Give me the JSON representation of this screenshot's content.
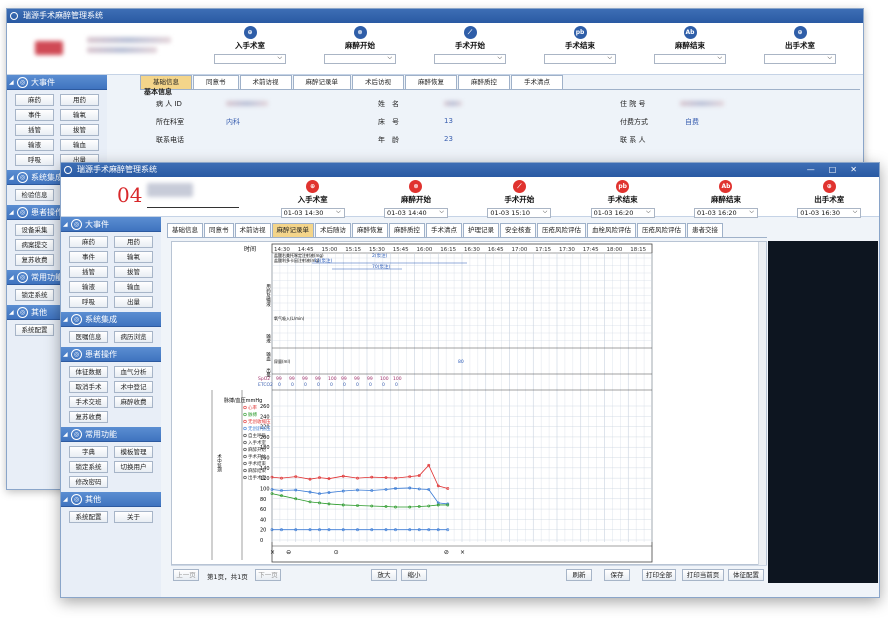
{
  "back_window": {
    "title": "瑞源手术麻醉管理系统",
    "steps": [
      {
        "label": "入手术室",
        "icon": "room-enter-icon",
        "glyph": "⊕"
      },
      {
        "label": "麻醉开始",
        "icon": "anesthesia-start-icon",
        "glyph": "⊗"
      },
      {
        "label": "手术开始",
        "icon": "scalpel-icon",
        "glyph": "⟋"
      },
      {
        "label": "手术结束",
        "icon": "surgery-end-icon",
        "glyph": "pb"
      },
      {
        "label": "麻醉结束",
        "icon": "anesthesia-end-icon",
        "glyph": "Ab"
      },
      {
        "label": "出手术室",
        "icon": "room-exit-icon",
        "glyph": "⊕"
      }
    ],
    "sidebar": {
      "groups": [
        {
          "label": "大事件",
          "buttons": [
            "麻药",
            "用药",
            "事件",
            "输氧",
            "插管",
            "拔管",
            "输液",
            "输血",
            "呼吸",
            "出量"
          ]
        },
        {
          "label": "系统集成",
          "buttons": [
            "检验信息",
            "病历浏览"
          ]
        },
        {
          "label": "患者操作",
          "buttons": [
            "设备采集",
            "血气分析",
            "病案提交",
            "手术交班",
            "复苏收费"
          ]
        },
        {
          "label": "常用功能",
          "buttons": [
            "锁定系统",
            "字典"
          ]
        },
        {
          "label": "其他",
          "buttons": [
            "系统配置"
          ]
        }
      ]
    },
    "tabs": [
      "基础信息",
      "同意书",
      "术前访视",
      "麻醉记录单",
      "术后访视",
      "麻醉恢复",
      "麻醉质控",
      "手术清点"
    ],
    "info": {
      "section_title": "基本信息",
      "patient_id_label": "病 人 ID",
      "name_label": "姓　名",
      "inpatient_no_label": "住 院 号",
      "dept_label": "所在科室",
      "dept_value": "内科",
      "bed_label": "床　号",
      "bed_value": "13",
      "pay_label": "付费方式",
      "pay_value": "自费",
      "phone_label": "联系电话",
      "age_label": "年　龄",
      "age_value": "23",
      "contact_label": "联 系 人"
    }
  },
  "front_window": {
    "title": "瑞源手术麻醉管理系统",
    "room_no": "04",
    "window_controls": [
      "—",
      "□",
      "✕"
    ],
    "steps": [
      {
        "label": "入手术室",
        "value": "01-03 14:30",
        "icon": "room-enter-icon",
        "glyph": "⊕"
      },
      {
        "label": "麻醉开始",
        "value": "01-03 14:40",
        "icon": "anesthesia-start-icon",
        "glyph": "⊗"
      },
      {
        "label": "手术开始",
        "value": "01-03 15:10",
        "icon": "scalpel-icon",
        "glyph": "⟋"
      },
      {
        "label": "手术结束",
        "value": "01-03 16:20",
        "icon": "surgery-end-icon",
        "glyph": "pb"
      },
      {
        "label": "麻醉结束",
        "value": "01-03 16:20",
        "icon": "anesthesia-end-icon",
        "glyph": "Ab"
      },
      {
        "label": "出手术室",
        "value": "01-03 16:30",
        "icon": "room-exit-icon",
        "glyph": "⊕"
      }
    ],
    "sidebar": {
      "groups": [
        {
          "label": "大事件",
          "buttons": [
            "麻药",
            "用药",
            "事件",
            "输氧",
            "插管",
            "拔管",
            "输液",
            "输血",
            "呼吸",
            "出量"
          ]
        },
        {
          "label": "系统集成",
          "buttons": [
            "医嘱信息",
            "病历浏览"
          ]
        },
        {
          "label": "患者操作",
          "buttons": [
            "体征数据",
            "血气分析",
            "取消手术",
            "术中登记",
            "手术交班",
            "麻醉收费",
            "复苏收费"
          ]
        },
        {
          "label": "常用功能",
          "buttons": [
            "字典",
            "模板管理",
            "锁定系统",
            "切换用户",
            "修改密码"
          ]
        },
        {
          "label": "其他",
          "buttons": [
            "系统配置",
            "关于"
          ]
        }
      ]
    },
    "tabs": [
      "基础信息",
      "同意书",
      "术前访视",
      "麻醉记录单",
      "术后随访",
      "麻醉恢复",
      "麻醉质控",
      "手术清点",
      "护理记录",
      "安全核查",
      "压疮风险评估",
      "血栓风险评估",
      "压疮风险评估",
      "患者交接"
    ],
    "active_tab": 3,
    "bottom": {
      "prev": "上一页",
      "page_info": "第1页，共1页",
      "next": "下一页",
      "zoom_in": "放大",
      "zoom_out": "缩小",
      "refresh": "刷新",
      "save": "保存",
      "print_all": "打印全部",
      "print_current": "打印当前页",
      "vitals_config": "体征配置"
    }
  },
  "chart_data": {
    "type": "line",
    "time_label": "时间",
    "times": [
      "14:30",
      "14:45",
      "15:00",
      "15:15",
      "15:30",
      "15:45",
      "16:00",
      "16:15",
      "16:30",
      "16:45",
      "17:00",
      "17:15",
      "17:30",
      "17:45",
      "18:00",
      "18:15"
    ],
    "section_labels": [
      "用药及输液",
      "输液",
      "输血",
      "出量"
    ],
    "drug_rows": [
      "盐酸右美托咪定注射液(mg)",
      "盐酸利多卡因注射液(mg)"
    ],
    "drug_marks": [
      "11(泵注)",
      "2(泵注)",
      "70(泵注)"
    ],
    "oxygen_label": "氧气吸入(L/min)",
    "urine_label": "尿量(ml)",
    "urine_value": "80",
    "spo2_label": "SpO2",
    "spo2_values": [
      "99",
      "99",
      "99",
      "99",
      "100",
      "99",
      "99",
      "99",
      "100",
      "100"
    ],
    "etco2_label": "ETCO2",
    "etco2_values": [
      "0",
      "0",
      "0",
      "0",
      "0",
      "0",
      "0",
      "0",
      "0",
      "0"
    ],
    "vitals_axis_title": "脉搏/血压mmHg",
    "y_ticks": [
      260,
      240,
      220,
      200,
      180,
      160,
      140,
      120,
      100,
      80,
      60,
      40,
      20,
      0
    ],
    "vitals_monitor_label": "术中监测",
    "legend": [
      {
        "label": "心率",
        "color": "#e03030"
      },
      {
        "label": "脉搏",
        "color": "#2a9a2a"
      },
      {
        "label": "无创收缩压",
        "color": "#e03030"
      },
      {
        "label": "无创舒张压",
        "color": "#3a7bd5"
      },
      {
        "label": "自主呼吸",
        "color": "#333333"
      },
      {
        "label": "入手术室",
        "color": "#333333"
      },
      {
        "label": "麻醉开始",
        "color": "#333333"
      },
      {
        "label": "手术开始",
        "color": "#333333"
      },
      {
        "label": "手术结束",
        "color": "#333333"
      },
      {
        "label": "麻醉结束",
        "color": "#333333"
      },
      {
        "label": "出手术室",
        "color": "#333333"
      }
    ],
    "series": [
      {
        "name": "无创收缩压",
        "color": "#e03030",
        "x": [
          14.5,
          14.6,
          14.75,
          14.9,
          15.0,
          15.1,
          15.25,
          15.4,
          15.55,
          15.7,
          15.8,
          15.95,
          16.05,
          16.15,
          16.25,
          16.35
        ],
        "y": [
          122,
          120,
          123,
          118,
          121,
          119,
          124,
          120,
          122,
          121,
          120,
          123,
          125,
          145,
          105,
          100
        ]
      },
      {
        "name": "无创舒张压",
        "color": "#3a7bd5",
        "x": [
          14.5,
          14.6,
          14.75,
          14.9,
          15.0,
          15.1,
          15.25,
          15.4,
          15.55,
          15.7,
          15.8,
          15.95,
          16.05,
          16.15,
          16.25,
          16.35
        ],
        "y": [
          98,
          96,
          97,
          93,
          90,
          92,
          95,
          97,
          96,
          98,
          100,
          101,
          99,
          98,
          72,
          70
        ]
      },
      {
        "name": "脉搏",
        "color": "#2a9a2a",
        "x": [
          14.5,
          14.6,
          14.75,
          14.9,
          15.0,
          15.1,
          15.25,
          15.4,
          15.55,
          15.7,
          15.8,
          15.95,
          16.05,
          16.15,
          16.25,
          16.35
        ],
        "y": [
          90,
          86,
          80,
          74,
          72,
          70,
          68,
          67,
          66,
          65,
          64,
          64,
          65,
          66,
          68,
          68
        ]
      },
      {
        "name": "自主呼吸",
        "color": "#3a7bd5",
        "x": [
          14.5,
          14.6,
          14.75,
          14.9,
          15.0,
          15.1,
          15.25,
          15.4,
          15.55,
          15.7,
          15.8,
          15.95,
          16.05,
          16.15,
          16.25,
          16.35
        ],
        "y": [
          20,
          20,
          20,
          20,
          20,
          20,
          20,
          20,
          20,
          20,
          20,
          20,
          20,
          20,
          20,
          20
        ]
      }
    ],
    "xlim": [
      14.5,
      18.5
    ],
    "ylim": [
      0,
      260
    ]
  }
}
